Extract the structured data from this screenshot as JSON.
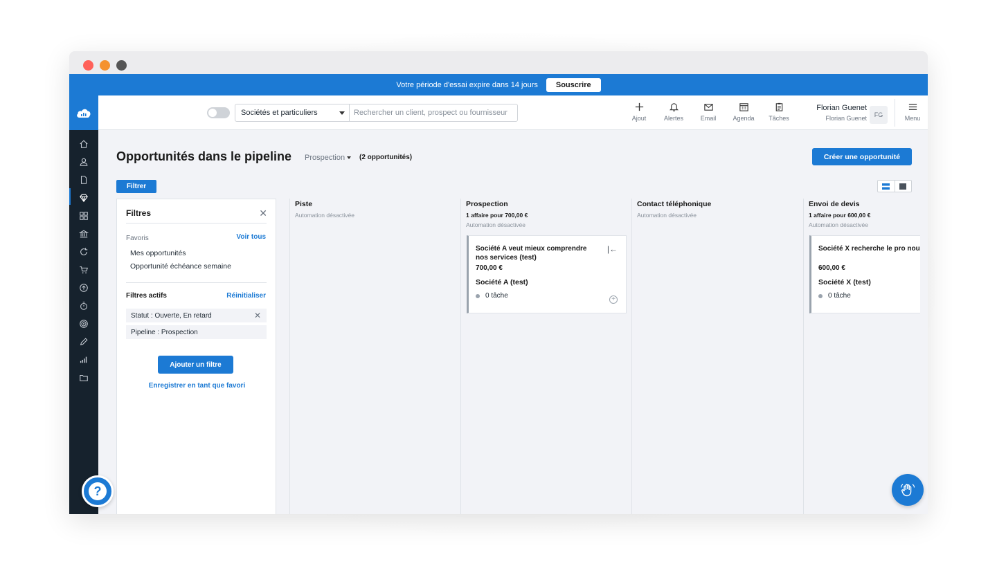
{
  "trial": {
    "text": "Votre période d'essai expire dans 14 jours",
    "button": "Souscrire"
  },
  "search": {
    "scope": "Sociétés et particuliers",
    "placeholder": "Rechercher un client, prospect ou fournisseur"
  },
  "toolbar": [
    {
      "icon": "plus-icon",
      "label": "Ajout"
    },
    {
      "icon": "bell-icon",
      "label": "Alertes"
    },
    {
      "icon": "mail-icon",
      "label": "Email"
    },
    {
      "icon": "calendar-icon",
      "label": "Agenda"
    },
    {
      "icon": "clipboard-icon",
      "label": "Tâches"
    }
  ],
  "user": {
    "name": "Florian Guenet",
    "company": "Florian Guenet",
    "initials": "FG"
  },
  "menu": {
    "label": "Menu"
  },
  "page": {
    "title": "Opportunités dans le pipeline",
    "pipeline": "Prospection",
    "count": "(2 opportunités)",
    "create_button": "Créer une opportunité",
    "filter_button": "Filtrer"
  },
  "filters": {
    "title": "Filtres",
    "favorites_label": "Favoris",
    "see_all": "Voir tous",
    "favorites": [
      "Mes opportunités",
      "Opportunité échéance semaine"
    ],
    "active_label": "Filtres actifs",
    "reset": "Réinitialiser",
    "active": [
      "Statut : Ouverte, En retard",
      "Pipeline : Prospection"
    ],
    "add_button": "Ajouter un filtre",
    "save_link": "Enregistrer en tant que favori"
  },
  "columns": [
    {
      "title": "Piste",
      "summary": "",
      "automation": "Automation désactivée"
    },
    {
      "title": "Prospection",
      "summary": "1 affaire pour 700,00 €",
      "automation": "Automation désactivée",
      "card": {
        "title": "Société A veut mieux comprendre nos services (test)",
        "amount": "700,00 €",
        "company": "Société A (test)",
        "tasks": "0 tâche"
      }
    },
    {
      "title": "Contact téléphonique",
      "summary": "",
      "automation": "Automation désactivée"
    },
    {
      "title": "Envoi de devis",
      "summary": "1 affaire pour 600,00 €",
      "automation": "Automation désactivée",
      "card": {
        "title": "Société X recherche le pro nous vendons (test)",
        "amount": "600,00 €",
        "company": "Société X (test)",
        "tasks": "0 tâche"
      }
    }
  ],
  "sidebar_icons": [
    "home-icon",
    "user-icon",
    "document-icon",
    "diamond-icon",
    "grid-icon",
    "bank-icon",
    "refresh-icon",
    "cart-icon",
    "upload-icon",
    "timer-icon",
    "target-icon",
    "pencil-icon",
    "chart-icon",
    "folder-icon"
  ],
  "colors": {
    "brand": "#1c7ad4",
    "sidebar": "#16222d"
  }
}
